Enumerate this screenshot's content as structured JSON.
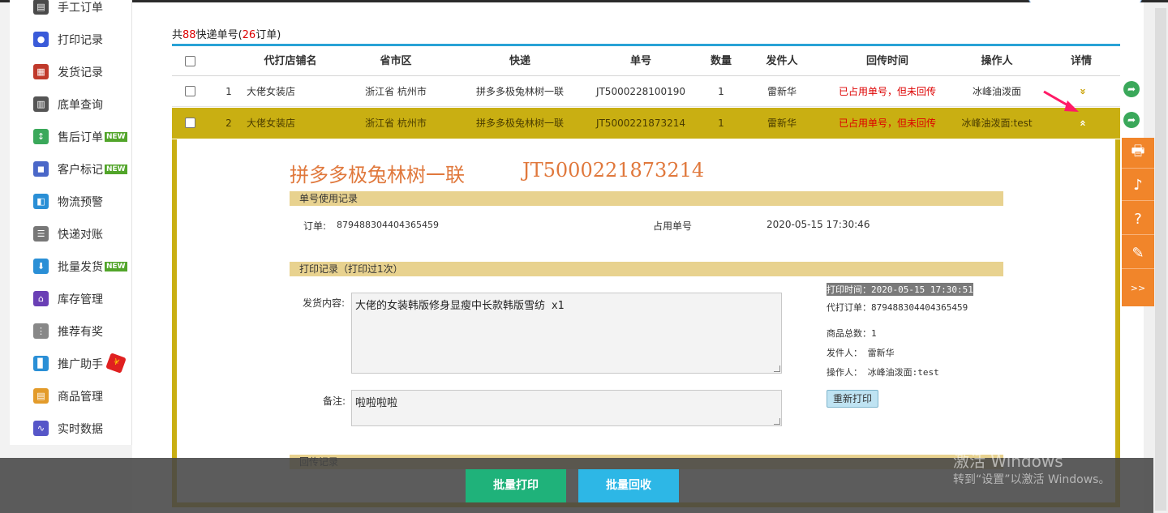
{
  "sidebar": {
    "items": [
      {
        "label": "手工订单",
        "icon": "manual-order-icon",
        "color": "#4a4a4a",
        "glyph": "▤"
      },
      {
        "label": "打印记录",
        "icon": "print-record-icon",
        "color": "#3a5bd9",
        "glyph": "●"
      },
      {
        "label": "发货记录",
        "icon": "ship-record-icon",
        "color": "#c0392b",
        "glyph": "▦"
      },
      {
        "label": "底单查询",
        "icon": "barcode-icon",
        "color": "#555555",
        "glyph": "▥"
      },
      {
        "label": "售后订单",
        "icon": "after-sale-icon",
        "color": "#3aa85a",
        "glyph": "↕",
        "badge": "NEW"
      },
      {
        "label": "客户标记",
        "icon": "customer-mark-icon",
        "color": "#4a67c8",
        "glyph": "◼",
        "badge": "NEW"
      },
      {
        "label": "物流预警",
        "icon": "logistics-alert-icon",
        "color": "#2a8fd6",
        "glyph": "◧"
      },
      {
        "label": "快递对账",
        "icon": "reconcile-icon",
        "color": "#777777",
        "glyph": "☰"
      },
      {
        "label": "批量发货",
        "icon": "batch-ship-icon",
        "color": "#2a8fd6",
        "glyph": "⬇",
        "badge": "NEW"
      },
      {
        "label": "库存管理",
        "icon": "inventory-icon",
        "color": "#6a3fb5",
        "glyph": "⌂"
      },
      {
        "label": "推荐有奖",
        "icon": "referral-icon",
        "color": "#888888",
        "glyph": "⋮"
      },
      {
        "label": "推广助手",
        "icon": "promo-icon",
        "color": "#2a8fd6",
        "glyph": "▊",
        "hongbao": true
      },
      {
        "label": "商品管理",
        "icon": "product-icon",
        "color": "#e39b2a",
        "glyph": "▤"
      },
      {
        "label": "实时数据",
        "icon": "realtime-data-icon",
        "color": "#5656c8",
        "glyph": "∿"
      }
    ]
  },
  "summary": {
    "prefix": "共",
    "total": "88",
    "mid": "快递单号(",
    "orders": "26",
    "suffix": "订单)"
  },
  "table": {
    "headers": [
      "代打店铺名",
      "省市区",
      "快递",
      "单号",
      "数量",
      "发件人",
      "回传时间",
      "操作人",
      "详情"
    ],
    "rows": [
      {
        "index": "1",
        "shop": "大佬女装店",
        "region": "浙江省 杭州市",
        "express": "拼多多极兔林树一联",
        "tracking": "JT5000228100190",
        "qty": "1",
        "sender": "雷新华",
        "status": "已占用单号，但未回传",
        "operator": "冰峰油泼面",
        "chevron": "»"
      },
      {
        "index": "2",
        "shop": "大佬女装店",
        "region": "浙江省 杭州市",
        "express": "拼多多极兔林树一联",
        "tracking": "JT5000221873214",
        "qty": "1",
        "sender": "雷新华",
        "status": "已占用单号，但未回传",
        "operator": "冰峰油泼面:test",
        "chevron": "«"
      }
    ]
  },
  "detail": {
    "express": "拼多多极兔林树一联",
    "tracking": "JT5000221873214",
    "usage_section": "单号使用记录",
    "order_label": "订单:",
    "order_value": "879488304404365459",
    "occupy_label": "占用单号",
    "occupy_time": "2020-05-15 17:30:46",
    "print_section": "打印记录（打印过1次）",
    "content_label": "发货内容:",
    "content_value": "大佬的女装韩版修身显瘦中长款韩版雪纺 x1",
    "remark_label": "备注:",
    "remark_value": "啦啦啦啦",
    "print_time": "打印时间：2020-05-15 17:30:51",
    "proxy_order": "代打订单：879488304404365459",
    "goods_total": "商品总数：1",
    "sender": "发件人： 雷新华",
    "operator": "操作人： 冰峰油泼面:test",
    "reprint": "重新打印",
    "return_section": "回传记录"
  },
  "toolbar": {
    "more": ">>"
  },
  "bottom": {
    "print": "批量打印",
    "recycle": "批量回收"
  },
  "watermark": {
    "line1": "激活 Windows",
    "line2": "转到“设置”以激活 Windows。"
  }
}
